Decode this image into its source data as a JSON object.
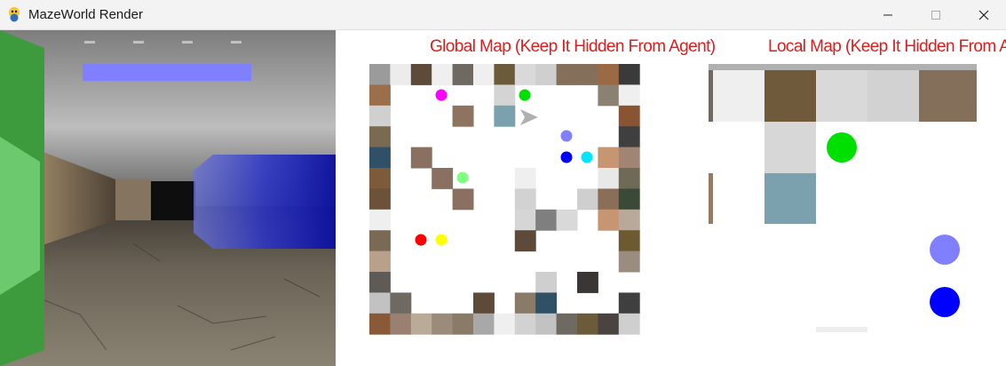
{
  "window": {
    "title": "MazeWorld Render",
    "icon": "pygame-snake-icon",
    "controls": [
      "minimize-icon",
      "maximize-icon",
      "close-icon"
    ]
  },
  "first_person_view": {
    "description_icon": "first-person-3d-view"
  },
  "global_map": {
    "title": "Global Map (Keep It Hidden From Agent)",
    "title_color": "#e21b1b",
    "grid_size": 13
  },
  "local_map": {
    "title": "Local Map (Keep It Hidden From Agent)",
    "title_color": "#e21b1b"
  },
  "colors": {
    "agent_arrow": "#b0b0b0",
    "objects": [
      "#ff00ff",
      "#00e000",
      "#8080ff",
      "#0000ff",
      "#00e5ff",
      "#80ff80",
      "#ff0000",
      "#ffff00"
    ]
  }
}
